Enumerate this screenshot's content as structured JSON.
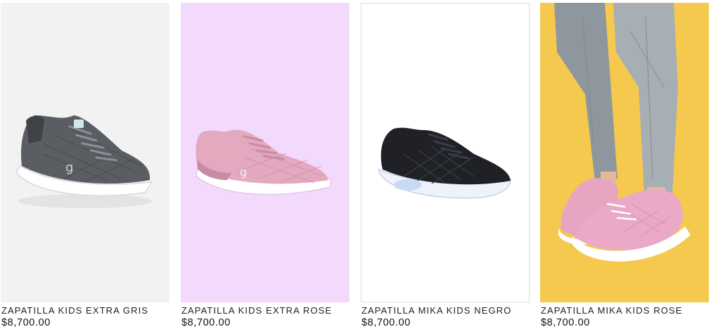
{
  "products": [
    {
      "name": "ZAPATILLA KIDS EXTRA GRIS",
      "price": "$8,700.00",
      "background": "#f2f2f3",
      "shoe_color": "#5a5e63"
    },
    {
      "name": "ZAPATILLA KIDS EXTRA ROSE",
      "price": "$8,700.00",
      "background": "#f3d9fb",
      "shoe_color": "#d99bb0"
    },
    {
      "name": "ZAPATILLA MIKA KIDS NEGRO",
      "price": "$8,700.00",
      "background": "#ffffff",
      "shoe_color": "#1f2126"
    },
    {
      "name": "ZAPATILLA MIKA KIDS ROSE",
      "price": "$8,700.00",
      "background": "#f5c94e",
      "shoe_color": "#e6a6c2"
    }
  ]
}
